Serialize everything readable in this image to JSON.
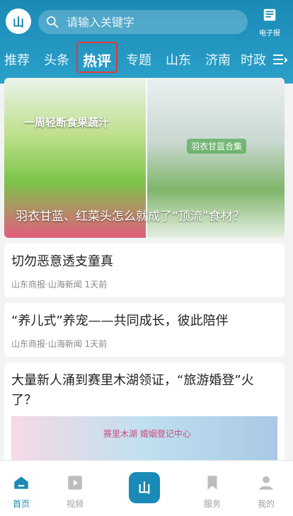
{
  "header": {
    "logo_text": "山",
    "search": {
      "placeholder": "请输入关键字"
    },
    "epaper_label": "电子报"
  },
  "tabs": [
    {
      "label": "推荐",
      "active": false
    },
    {
      "label": "头条",
      "active": false
    },
    {
      "label": "热评",
      "active": true
    },
    {
      "label": "专题",
      "active": false
    },
    {
      "label": "山东",
      "active": false
    },
    {
      "label": "济南",
      "active": false
    },
    {
      "label": "时政",
      "active": false
    }
  ],
  "feed": {
    "hero": {
      "caption": "羽衣甘蓝、红菜头怎么就成了“顶流”食材？",
      "overlay_left": "一周轻断食果蔬汁",
      "overlay_right": "羽衣甘蓝合集"
    },
    "articles": [
      {
        "title": "切勿恶意透支童真",
        "meta": "山东商报·山海新闻  1天前"
      },
      {
        "title": "“养儿式”养宠——共同成长，彼此陪伴",
        "meta": "山东商报·山海新闻  1天前"
      },
      {
        "title": "大量新人涌到赛里木湖领证，“旅游婚登”火了？",
        "thumb_text": "赛里木湖 婚姻登记中心"
      }
    ]
  },
  "bottom_nav": [
    {
      "label": "首页",
      "icon": "home-icon",
      "active": true
    },
    {
      "label": "视频",
      "icon": "video-icon",
      "active": false
    },
    {
      "label": "",
      "icon": "app-logo-icon",
      "active": false
    },
    {
      "label": "服务",
      "icon": "bookmark-icon",
      "active": false
    },
    {
      "label": "我的",
      "icon": "user-icon",
      "active": false
    }
  ],
  "colors": {
    "header_start": "#1b8ab6",
    "header_end": "#2aa0c9",
    "active_outline": "#e53935",
    "nav_active": "#1b8ab6"
  }
}
